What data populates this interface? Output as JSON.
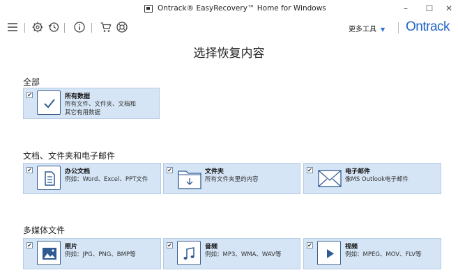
{
  "window": {
    "title": "Ontrack® EasyRecovery™ Home for Windows",
    "minimize": "–",
    "maximize": "☐",
    "close": "✕"
  },
  "toolbar": {
    "more_tools": "更多工具",
    "logo": "Ontrack",
    "icons": [
      "menu-icon",
      "gear-icon",
      "history-icon",
      "info-icon",
      "cart-icon",
      "support-icon"
    ]
  },
  "main": {
    "title": "选择恢复内容",
    "sections": [
      {
        "title": "全部",
        "cards": [
          {
            "title": "所有数据",
            "desc": "所有文件、文件夹、文档和其它有用数据",
            "icon": "check-icon",
            "checked": true
          }
        ]
      },
      {
        "title": "文档、文件夹和电子邮件",
        "cards": [
          {
            "title": "办公文档",
            "desc": "例如：Word、Excel、PPT文件",
            "icon": "document-icon",
            "checked": true
          },
          {
            "title": "文件夹",
            "desc": "所有文件夹里的内容",
            "icon": "folder-icon",
            "checked": true
          },
          {
            "title": "电子邮件",
            "desc": "像MS Outlook电子邮件",
            "icon": "email-icon",
            "checked": true
          }
        ]
      },
      {
        "title": "多媒体文件",
        "cards": [
          {
            "title": "照片",
            "desc": "例如：JPG、PNG、BMP等",
            "icon": "photo-icon",
            "checked": true
          },
          {
            "title": "音频",
            "desc": "例如：MP3、WMA、WAV等",
            "icon": "music-icon",
            "checked": true
          },
          {
            "title": "视频",
            "desc": "例如：MPEG、MOV、FLV等",
            "icon": "video-icon",
            "checked": true
          }
        ]
      }
    ]
  },
  "colors": {
    "card_bg": "#d5e5f6",
    "card_border": "#b6cbe3",
    "icon_stroke": "#3b5f8f",
    "brand": "#1e63c4"
  }
}
